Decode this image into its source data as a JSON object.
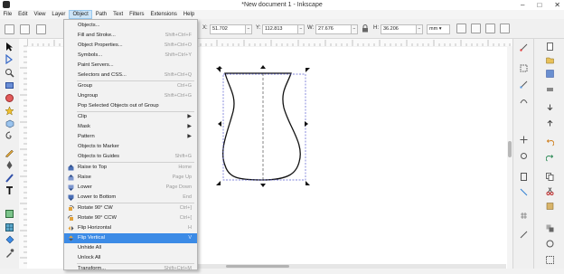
{
  "window": {
    "title": "*New document 1 - Inkscape",
    "minimize": "–",
    "maximize": "□",
    "close": "✕"
  },
  "menubar": [
    "File",
    "Edit",
    "View",
    "Layer",
    "Object",
    "Path",
    "Text",
    "Filters",
    "Extensions",
    "Help"
  ],
  "active_menu": "Object",
  "toolbar": {
    "x_label": "X:",
    "x_value": "51.702",
    "y_label": "Y:",
    "y_value": "112.813",
    "w_label": "W:",
    "w_value": "27.676",
    "h_label": "H:",
    "h_value": "36.206",
    "unit": "mm",
    "spin_minus": "−",
    "spin_plus": "+",
    "lock_icon": "lock-icon"
  },
  "object_menu": [
    {
      "label": "Objects...",
      "shortcut": "",
      "icon": ""
    },
    {
      "label": "Fill and Stroke...",
      "shortcut": "Shift+Ctrl+F",
      "icon": ""
    },
    {
      "label": "Object Properties...",
      "shortcut": "Shift+Ctrl+O",
      "icon": ""
    },
    {
      "label": "Symbols...",
      "shortcut": "Shift+Ctrl+Y",
      "icon": ""
    },
    {
      "label": "Paint Servers...",
      "shortcut": "",
      "icon": ""
    },
    {
      "label": "Selectors and CSS...",
      "shortcut": "Shift+Ctrl+Q",
      "icon": ""
    },
    {
      "sep": true
    },
    {
      "label": "Group",
      "shortcut": "Ctrl+G",
      "icon": ""
    },
    {
      "label": "Ungroup",
      "shortcut": "Shift+Ctrl+G",
      "icon": ""
    },
    {
      "label": "Pop Selected Objects out of Group",
      "shortcut": "",
      "icon": ""
    },
    {
      "sep": true
    },
    {
      "label": "Clip",
      "submenu": true
    },
    {
      "label": "Mask",
      "submenu": true
    },
    {
      "label": "Pattern",
      "submenu": true
    },
    {
      "label": "Objects to Marker",
      "shortcut": ""
    },
    {
      "label": "Objects to Guides",
      "shortcut": "Shift+G"
    },
    {
      "sep": true
    },
    {
      "label": "Raise to Top",
      "shortcut": "Home",
      "icon": "raise-to-top-icon"
    },
    {
      "label": "Raise",
      "shortcut": "Page Up",
      "icon": "raise-icon"
    },
    {
      "label": "Lower",
      "shortcut": "Page Down",
      "icon": "lower-icon"
    },
    {
      "label": "Lower to Bottom",
      "shortcut": "End",
      "icon": "lower-to-bottom-icon"
    },
    {
      "sep": true
    },
    {
      "label": "Rotate 90° CW",
      "shortcut": "Ctrl+]",
      "icon": "rotate-cw-icon"
    },
    {
      "label": "Rotate 90° CCW",
      "shortcut": "Ctrl+[",
      "icon": "rotate-ccw-icon"
    },
    {
      "label": "Flip Horizontal",
      "shortcut": "H",
      "icon": "flip-horizontal-icon"
    },
    {
      "label": "Flip Vertical",
      "shortcut": "V",
      "icon": "flip-vertical-icon",
      "highlighted": true
    },
    {
      "label": "Unhide All",
      "shortcut": ""
    },
    {
      "label": "Unlock All",
      "shortcut": ""
    },
    {
      "sep": true
    },
    {
      "label": "Transform...",
      "shortcut": "Shift+Ctrl+M"
    }
  ],
  "colors": {
    "highlight": "#3c8be6",
    "selection_dash": "#5a5fd0",
    "menu_bg": "#f2f2f2"
  }
}
